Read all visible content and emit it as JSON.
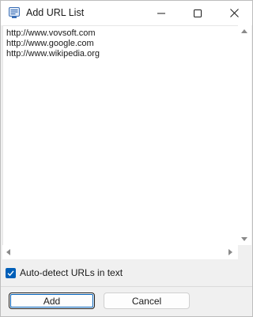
{
  "window": {
    "title": "Add URL List",
    "icons": {
      "app": "app-list-icon",
      "minimize": "minimize-icon",
      "maximize": "maximize-icon",
      "close": "close-icon"
    }
  },
  "editor": {
    "lines": [
      "http://www.vovsoft.com",
      "http://www.google.com",
      "http://www.wikipedia.org"
    ]
  },
  "options": {
    "auto_detect_label": "Auto-detect URLs in text",
    "auto_detect_checked": true
  },
  "buttons": {
    "add_label": "Add",
    "cancel_label": "Cancel"
  },
  "colors": {
    "accent": "#005fb8",
    "border": "#d0d0d0"
  }
}
